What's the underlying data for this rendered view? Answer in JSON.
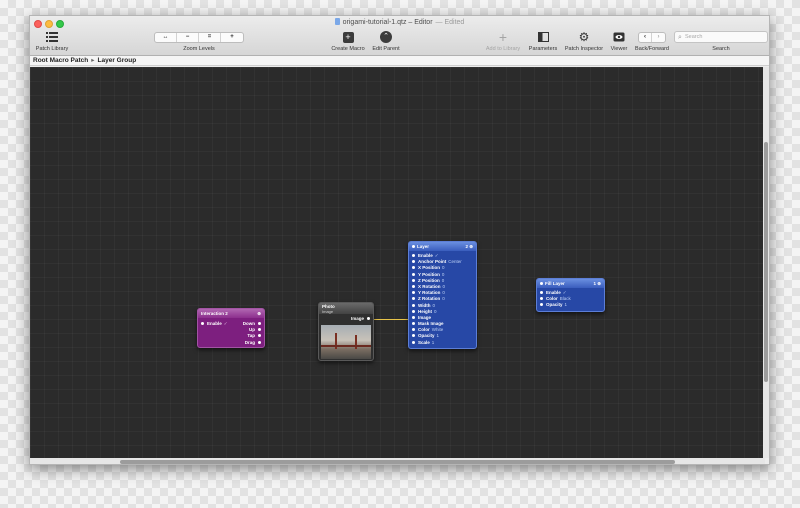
{
  "window": {
    "title": "origami-tutorial-1.qtz – Editor",
    "edited": "— Edited"
  },
  "toolbar": {
    "patch_library": "Patch Library",
    "zoom": {
      "label": "Zoom Levels",
      "buttons": [
        "↔",
        "−",
        "=",
        "+"
      ]
    },
    "create_macro": "Create Macro",
    "edit_parent": "Edit Parent",
    "add_to_library": "Add to Library",
    "parameters": "Parameters",
    "patch_inspector": "Patch Inspector",
    "viewer": "Viewer",
    "back_forward": "Back/Forward",
    "search_label": "Search",
    "search_placeholder": "Search"
  },
  "breadcrumb": {
    "root": "Root Macro Patch",
    "separator": "▸",
    "current": "Layer Group"
  },
  "patches": {
    "interaction": {
      "title": "Interaction 2",
      "badge": "⊕",
      "input": "Enable",
      "outputs": [
        "Down",
        "Up",
        "Tap",
        "Drag"
      ]
    },
    "photo": {
      "title": "Photo",
      "subtitle": "Image",
      "output": "Image"
    },
    "layer": {
      "title": "Layer",
      "badge": "2 ⊕",
      "ports": [
        {
          "name": "Enable",
          "value": "✓"
        },
        {
          "name": "Anchor Point",
          "value": "Center"
        },
        {
          "name": "X Position",
          "value": "0"
        },
        {
          "name": "Y Position",
          "value": "0"
        },
        {
          "name": "Z Position",
          "value": "0"
        },
        {
          "name": "X Rotation",
          "value": "0"
        },
        {
          "name": "Y Rotation",
          "value": "0"
        },
        {
          "name": "Z Rotation",
          "value": "0"
        },
        {
          "name": "Width",
          "value": "0"
        },
        {
          "name": "Height",
          "value": "0"
        },
        {
          "name": "Image",
          "value": ""
        },
        {
          "name": "Mask Image",
          "value": ""
        },
        {
          "name": "Color",
          "value": "White"
        },
        {
          "name": "Opacity",
          "value": "1"
        },
        {
          "name": "Scale",
          "value": "1"
        }
      ]
    },
    "fill": {
      "title": "Fill Layer",
      "badge": "1 ⊕",
      "ports": [
        {
          "name": "Enable",
          "value": "✓"
        },
        {
          "name": "Color",
          "value": "Black"
        },
        {
          "name": "Opacity",
          "value": "1"
        }
      ]
    }
  },
  "colors": {
    "canvas": "#2b2b2b",
    "interaction_patch": "#7d1f7f",
    "layer_patch": "#2748a6",
    "wire": "#e8c44a"
  }
}
